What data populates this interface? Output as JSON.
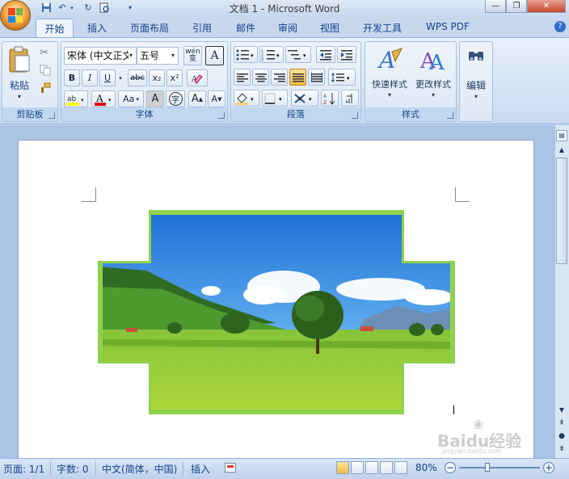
{
  "window": {
    "title": "文档 1 - Microsoft Word"
  },
  "tabs": [
    "开始",
    "插入",
    "页面布局",
    "引用",
    "邮件",
    "审阅",
    "视图",
    "开发工具",
    "WPS PDF"
  ],
  "clipboard": {
    "paste_label": "粘贴",
    "group_label": "剪贴板"
  },
  "font": {
    "name": "宋体 (中文正文",
    "size": "五号",
    "group_label": "字体",
    "wen_glyph": "wén 变",
    "bold": "B",
    "italic": "I",
    "underline": "U",
    "strike": "abc",
    "subscript": "x₂",
    "superscript": "x²",
    "case": "Aa",
    "grow": "A",
    "shrink": "A",
    "char_border": "A",
    "char_shading": "A",
    "enclose": "字"
  },
  "paragraph": {
    "group_label": "段落"
  },
  "styles": {
    "quick_label": "快速样式",
    "change_label": "更改样式",
    "group_label": "样式"
  },
  "editing": {
    "label": "编辑"
  },
  "status": {
    "page": "页面: 1/1",
    "words": "字数: 0",
    "lang": "中文(简体，中国)",
    "insert_mode": "插入",
    "zoom": "80%"
  },
  "watermark": {
    "text": "Baidu经验",
    "sub": "jingyan.baidu.com"
  },
  "colors": {
    "accent": "#15428b",
    "highlight": "#ffff00",
    "font_color": "#e00000",
    "frame": "#8fd14f"
  }
}
